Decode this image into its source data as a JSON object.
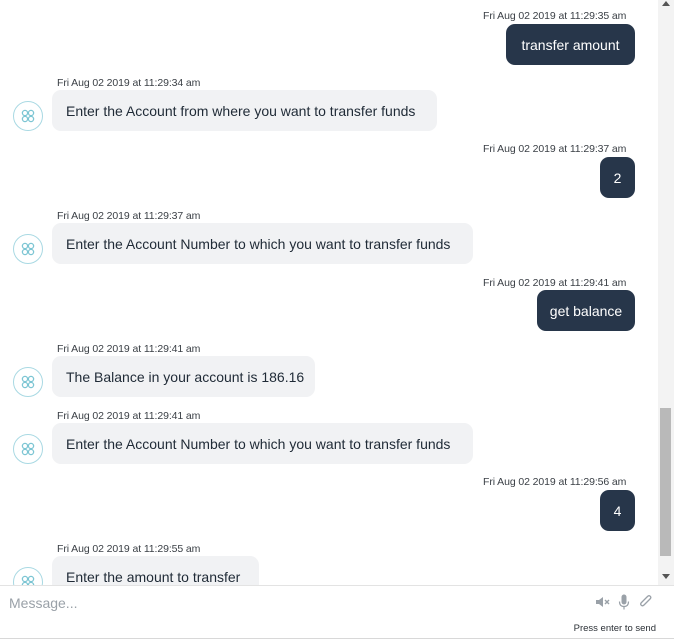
{
  "messages": [
    {
      "sender": "user",
      "time": "Fri Aug 02 2019 at 11:29:35 am",
      "text": "transfer amount"
    },
    {
      "sender": "bot",
      "time": "Fri Aug 02 2019 at 11:29:34 am",
      "text": "Enter the Account from where you want to transfer funds"
    },
    {
      "sender": "user",
      "time": "Fri Aug 02 2019 at 11:29:37 am",
      "text": "2"
    },
    {
      "sender": "bot",
      "time": "Fri Aug 02 2019 at 11:29:37 am",
      "text": "Enter the Account Number to which you want to transfer funds"
    },
    {
      "sender": "user",
      "time": "Fri Aug 02 2019 at 11:29:41 am",
      "text": "get balance"
    },
    {
      "sender": "bot",
      "time": "Fri Aug 02 2019 at 11:29:41 am",
      "text": "The Balance in your account is 186.16"
    },
    {
      "sender": "bot",
      "time": "Fri Aug 02 2019 at 11:29:41 am",
      "text": "Enter the Account Number to which you want to transfer funds"
    },
    {
      "sender": "user",
      "time": "Fri Aug 02 2019 at 11:29:56 am",
      "text": "4"
    },
    {
      "sender": "bot",
      "time": "Fri Aug 02 2019 at 11:29:55 am",
      "text": "Enter the amount to transfer"
    }
  ],
  "composer": {
    "placeholder": "Message...",
    "hint": "Press enter to send"
  },
  "icons": {
    "bot_avatar": "bot-avatar-icon",
    "mute": "speaker-mute-icon",
    "mic": "microphone-icon",
    "attach": "paperclip-icon"
  },
  "colors": {
    "user_bubble": "#27364a",
    "bot_bubble": "#f1f2f4",
    "avatar_ring": "#a9d9e3"
  }
}
